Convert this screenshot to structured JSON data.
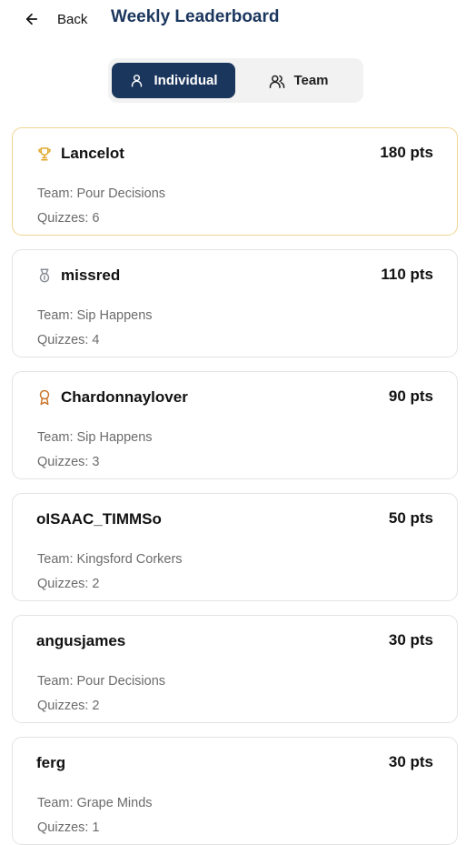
{
  "header": {
    "back_label": "Back",
    "title": "Weekly Leaderboard"
  },
  "toggle": {
    "individual_label": "Individual",
    "team_label": "Team",
    "selected": "Individual"
  },
  "colors": {
    "primary": "#1b365d",
    "gold": "#e0a82e",
    "silver": "#8a8f98",
    "bronze": "#c9762b"
  },
  "entries": [
    {
      "name": "Lancelot",
      "points": "180 pts",
      "team": "Team: Pour Decisions",
      "quizzes": "Quizzes: 6",
      "icon": "trophy-icon"
    },
    {
      "name": "missred",
      "points": "110 pts",
      "team": "Team: Sip Happens",
      "quizzes": "Quizzes: 4",
      "icon": "medal-icon"
    },
    {
      "name": "Chardonnaylover",
      "points": "90 pts",
      "team": "Team: Sip Happens",
      "quizzes": "Quizzes: 3",
      "icon": "award-icon"
    },
    {
      "name": "oISAAC_TIMMSo",
      "points": "50 pts",
      "team": "Team: Kingsford Corkers",
      "quizzes": "Quizzes: 2"
    },
    {
      "name": "angusjames",
      "points": "30 pts",
      "team": "Team: Pour Decisions",
      "quizzes": "Quizzes: 2"
    },
    {
      "name": "ferg",
      "points": "30 pts",
      "team": "Team: Grape Minds",
      "quizzes": "Quizzes: 1"
    }
  ]
}
